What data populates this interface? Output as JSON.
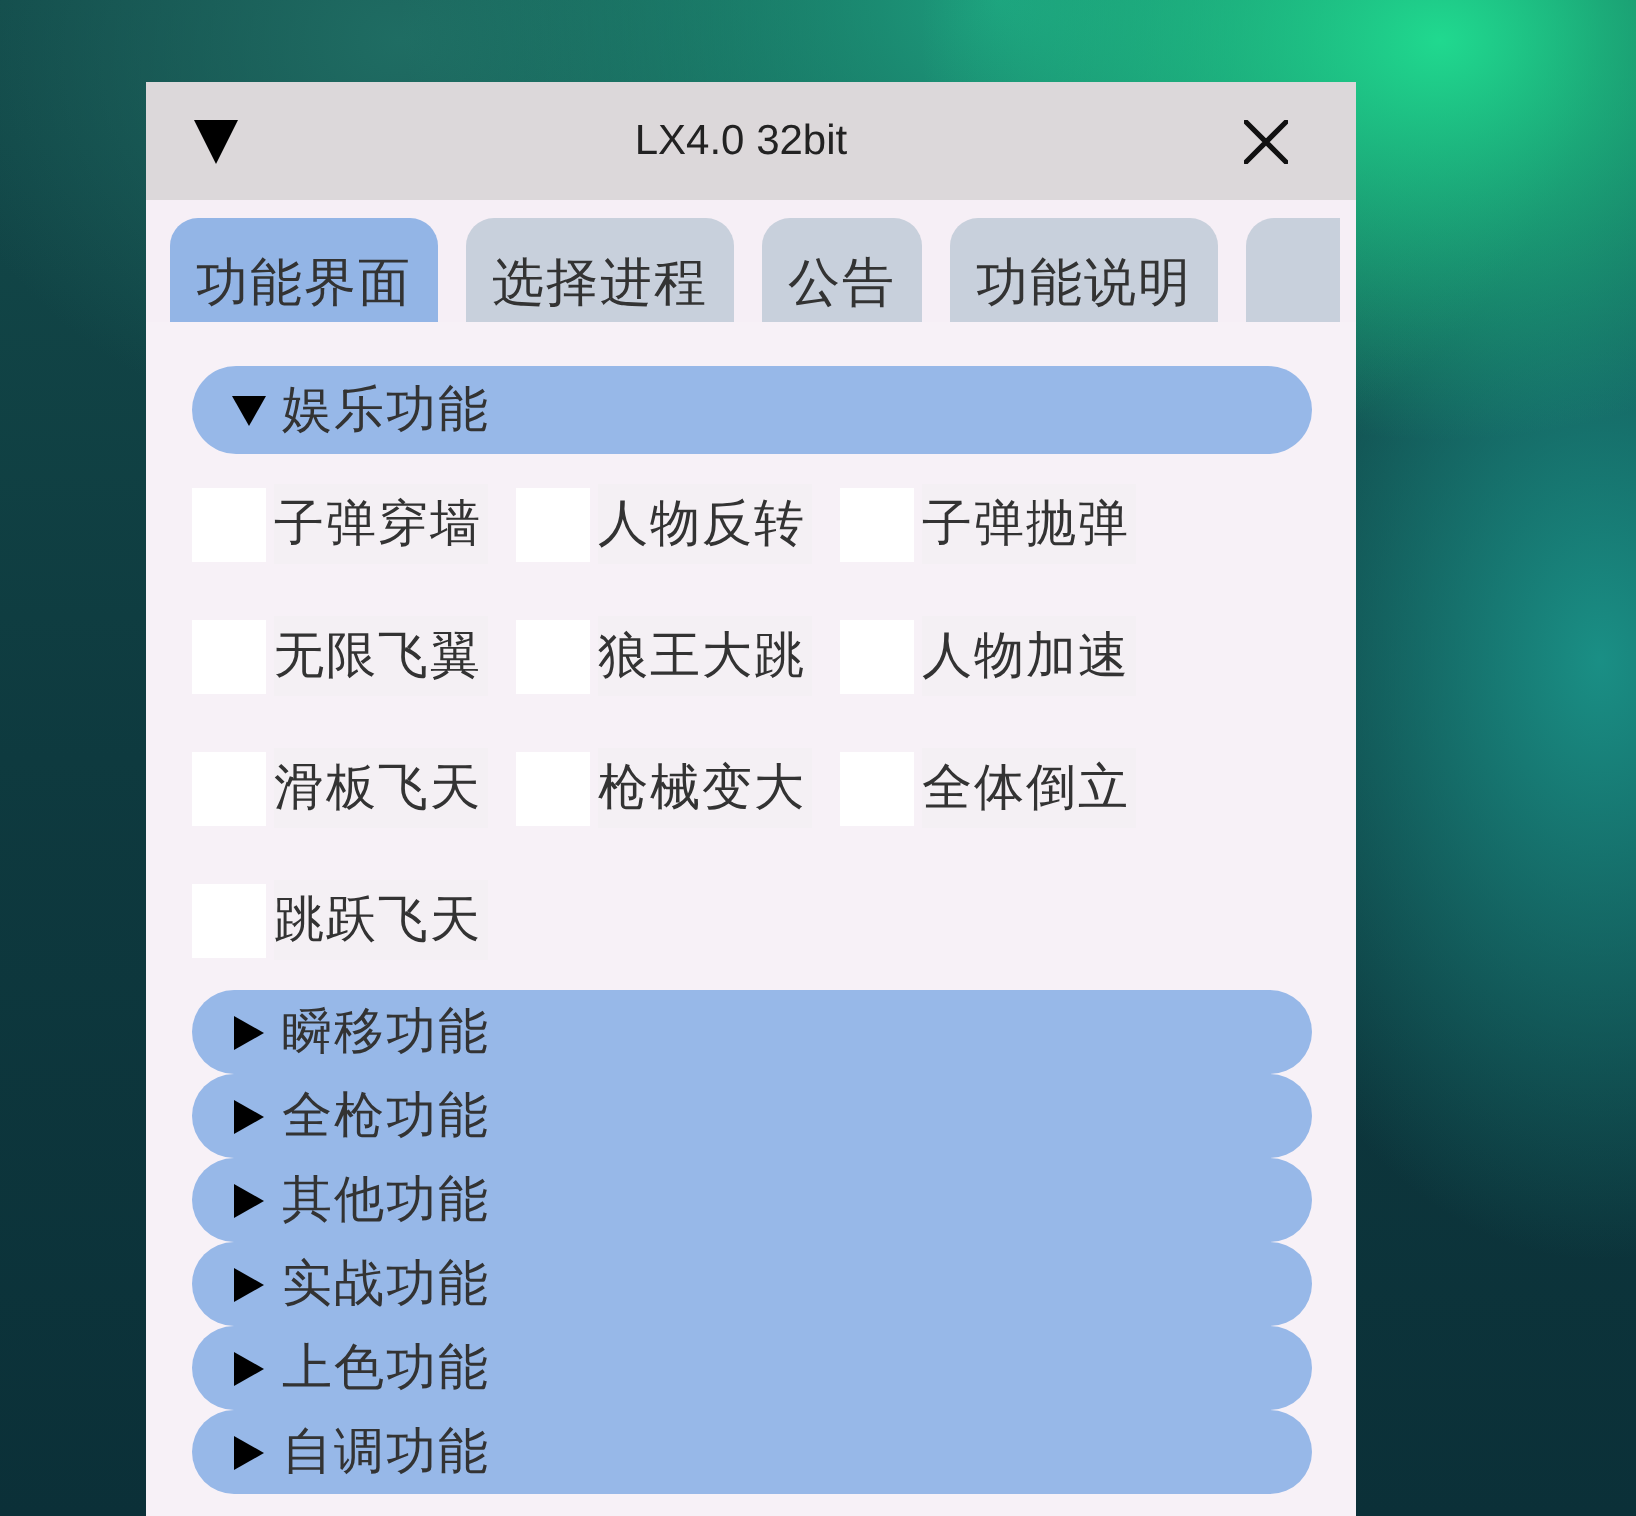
{
  "window": {
    "title": "LX4.0 32bit"
  },
  "tabs": [
    {
      "label": "功能界面",
      "selected": true
    },
    {
      "label": "选择进程",
      "selected": false
    },
    {
      "label": "公告",
      "selected": false
    },
    {
      "label": "功能说明",
      "selected": false
    },
    {
      "selected": false
    }
  ],
  "sections": [
    {
      "label": "娱乐功能",
      "expanded": true,
      "items": [
        {
          "label": "子弹穿墙",
          "checked": false
        },
        {
          "label": "人物反转",
          "checked": false
        },
        {
          "label": "子弹抛弹",
          "checked": false
        },
        {
          "label": "无限飞翼",
          "checked": false
        },
        {
          "label": "狼王大跳",
          "checked": false
        },
        {
          "label": "人物加速",
          "checked": false
        },
        {
          "label": "滑板飞天",
          "checked": false
        },
        {
          "label": "枪械变大",
          "checked": false
        },
        {
          "label": "全体倒立",
          "checked": false
        },
        {
          "label": "跳跃飞天",
          "checked": false
        }
      ]
    },
    {
      "label": "瞬移功能",
      "expanded": false
    },
    {
      "label": "全枪功能",
      "expanded": false
    },
    {
      "label": "其他功能",
      "expanded": false
    },
    {
      "label": "实战功能",
      "expanded": false
    },
    {
      "label": "上色功能",
      "expanded": false
    },
    {
      "label": "自调功能",
      "expanded": false
    }
  ]
}
